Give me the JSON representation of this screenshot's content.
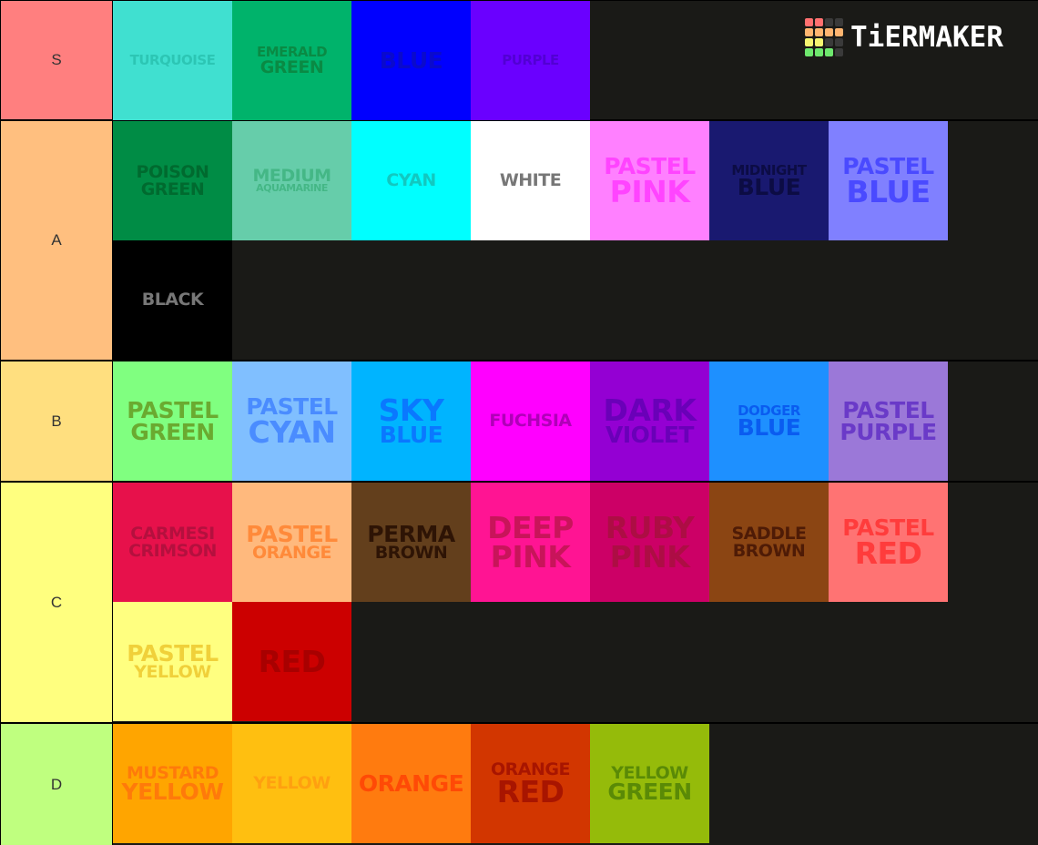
{
  "logo": {
    "text": "TiERMAKER",
    "grid_colors": [
      "#ff7070",
      "#ff7070",
      "#3a3a3a",
      "#3a3a3a",
      "#ffb570",
      "#ffb570",
      "#ffb570",
      "#ffb570",
      "#f5f570",
      "#f5f570",
      "#3a3a3a",
      "#3a3a3a",
      "#6ee86e",
      "#6ee86e",
      "#6ee86e",
      "#3a3a3a"
    ]
  },
  "tiers": [
    {
      "label": "S",
      "color": "#ff7f7f",
      "items": [
        {
          "l1": "TURQUOISE",
          "l2": "",
          "bg": "#40e0d0",
          "fg": "#2cc6b4",
          "s1": "sz-s",
          "s2": ""
        },
        {
          "l1": "EMERALD",
          "l2": "GREEN",
          "bg": "#00b36b",
          "fg": "#0a8a44",
          "s1": "sz-s",
          "s2": "sz-m"
        },
        {
          "l1": "BLUE",
          "l2": "",
          "bg": "#0000ff",
          "fg": "#0a0acc",
          "s1": "sz-l",
          "s2": ""
        },
        {
          "l1": "PURPLE",
          "l2": "",
          "bg": "#6a00ff",
          "fg": "#5200d4",
          "s1": "sz-s",
          "s2": ""
        }
      ]
    },
    {
      "label": "A",
      "color": "#ffbf7f",
      "items": [
        {
          "l1": "POISON",
          "l2": "GREEN",
          "bg": "#008c45",
          "fg": "#006a2f",
          "s1": "sz-m",
          "s2": "sz-m"
        },
        {
          "l1": "MEDIUM",
          "l2": "AQUAMARINE",
          "bg": "#66cdaa",
          "fg": "#44b786",
          "s1": "sz-m",
          "s2": "sz-xs"
        },
        {
          "l1": "CYAN",
          "l2": "",
          "bg": "#00ffff",
          "fg": "#12c8c0",
          "s1": "sz-m",
          "s2": ""
        },
        {
          "l1": "WHITE",
          "l2": "",
          "bg": "#ffffff",
          "fg": "#777777",
          "s1": "sz-m",
          "s2": ""
        },
        {
          "l1": "PASTEL",
          "l2": "PINK",
          "bg": "#ff80ff",
          "fg": "#ff44ff",
          "s1": "sz-l",
          "s2": "sz-xl"
        },
        {
          "l1": "MIDNIGHT",
          "l2": "BLUE",
          "bg": "#191970",
          "fg": "#0c0c44",
          "s1": "sz-s",
          "s2": "sz-l"
        },
        {
          "l1": "PASTEL",
          "l2": "BLUE",
          "bg": "#8080ff",
          "fg": "#4a4aff",
          "s1": "sz-l",
          "s2": "sz-xl"
        },
        {
          "l1": "BLACK",
          "l2": "",
          "bg": "#000000",
          "fg": "#777777",
          "s1": "sz-m",
          "s2": ""
        }
      ]
    },
    {
      "label": "B",
      "color": "#ffdf7f",
      "items": [
        {
          "l1": "PASTEL",
          "l2": "GREEN",
          "bg": "#80ff80",
          "fg": "#6aaa30",
          "s1": "sz-l",
          "s2": "sz-l"
        },
        {
          "l1": "PASTEL",
          "l2": "CYAN",
          "bg": "#80bfff",
          "fg": "#4a8cff",
          "s1": "sz-l",
          "s2": "sz-xl"
        },
        {
          "l1": "SKY",
          "l2": "BLUE",
          "bg": "#00b4ff",
          "fg": "#0a78ff",
          "s1": "sz-xl",
          "s2": "sz-l"
        },
        {
          "l1": "FUCHSIA",
          "l2": "",
          "bg": "#ff00ff",
          "fg": "#b000b8",
          "s1": "sz-m",
          "s2": ""
        },
        {
          "l1": "DARK",
          "l2": "VIOLET",
          "bg": "#9400d3",
          "fg": "#6a00b8",
          "s1": "sz-xl",
          "s2": "sz-l"
        },
        {
          "l1": "DODGER",
          "l2": "BLUE",
          "bg": "#1e90ff",
          "fg": "#0a5cf0",
          "s1": "sz-s",
          "s2": "sz-l"
        },
        {
          "l1": "PASTEL",
          "l2": "PURPLE",
          "bg": "#9b78d8",
          "fg": "#6a3ac8",
          "s1": "sz-l",
          "s2": "sz-l"
        }
      ]
    },
    {
      "label": "C",
      "color": "#ffff7f",
      "items": [
        {
          "l1": "CARMESI",
          "l2": "CRIMSON",
          "bg": "#e7114b",
          "fg": "#b4103e",
          "s1": "sz-m",
          "s2": "sz-m"
        },
        {
          "l1": "PASTEL",
          "l2": "ORANGE",
          "bg": "#ffb97d",
          "fg": "#ff8a3a",
          "s1": "sz-l",
          "s2": "sz-m"
        },
        {
          "l1": "PERMA",
          "l2": "BROWN",
          "bg": "#633f1c",
          "fg": "#2e1405",
          "s1": "sz-l",
          "s2": "sz-m"
        },
        {
          "l1": "DEEP",
          "l2": "PINK",
          "bg": "#ff1493",
          "fg": "#c8145a",
          "s1": "sz-xl",
          "s2": "sz-xl"
        },
        {
          "l1": "RUBY",
          "l2": "PINK",
          "bg": "#cc0066",
          "fg": "#ad0d44",
          "s1": "sz-xl",
          "s2": "sz-xl"
        },
        {
          "l1": "SADDLE",
          "l2": "BROWN",
          "bg": "#8b4513",
          "fg": "#4e1b06",
          "s1": "sz-m",
          "s2": "sz-m"
        },
        {
          "l1": "PASTEL",
          "l2": "RED",
          "bg": "#ff7373",
          "fg": "#ff3c3c",
          "s1": "sz-l",
          "s2": "sz-xl"
        },
        {
          "l1": "PASTEL",
          "l2": "YELLOW",
          "bg": "#ffff80",
          "fg": "#f0d03a",
          "s1": "sz-l",
          "s2": "sz-m"
        },
        {
          "l1": "RED",
          "l2": "",
          "bg": "#cc0000",
          "fg": "#a80000",
          "s1": "sz-xl",
          "s2": ""
        }
      ]
    },
    {
      "label": "D",
      "color": "#bfff7f",
      "items": [
        {
          "l1": "MUSTARD",
          "l2": "YELLOW",
          "bg": "#ffa500",
          "fg": "#ff7a0a",
          "s1": "sz-m",
          "s2": "sz-l"
        },
        {
          "l1": "YELLOW",
          "l2": "",
          "bg": "#ffbf10",
          "fg": "#ffa010",
          "s1": "sz-m",
          "s2": ""
        },
        {
          "l1": "ORANGE",
          "l2": "",
          "bg": "#ff7b0f",
          "fg": "#ff4a06",
          "s1": "sz-l",
          "s2": ""
        },
        {
          "l1": "ORANGE",
          "l2": "RED",
          "bg": "#d23600",
          "fg": "#a81500",
          "s1": "sz-m",
          "s2": "sz-xl"
        },
        {
          "l1": "YELLOW",
          "l2": "GREEN",
          "bg": "#95bb0a",
          "fg": "#5a8a06",
          "s1": "sz-m",
          "s2": "sz-l"
        }
      ]
    }
  ]
}
